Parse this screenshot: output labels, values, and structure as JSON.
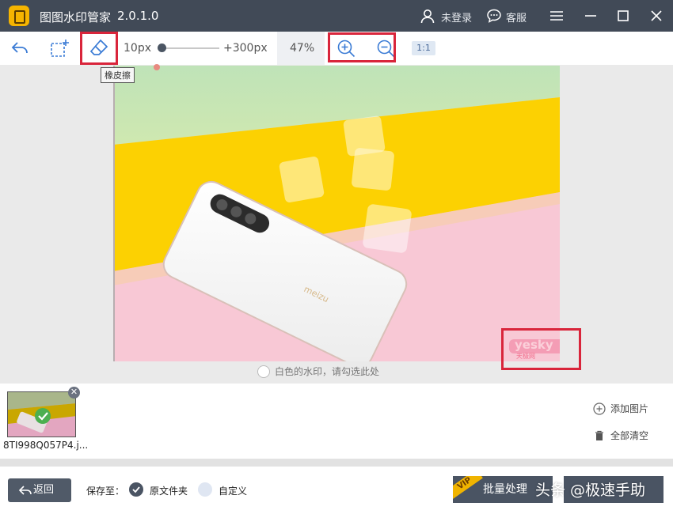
{
  "window": {
    "title": "图图水印管家",
    "version": "2.0.1.0",
    "login_label": "未登录",
    "service_label": "客服"
  },
  "toolbar": {
    "brush_min": "10px",
    "brush_max": "+300px",
    "zoom_level": "47%",
    "ratio_label": "1:1",
    "brush_level": 0.0
  },
  "tooltip": {
    "eraser": "橡皮擦"
  },
  "canvas": {
    "white_watermark_option": "白色的水印，请勾选此处",
    "photo_watermark": "yesky",
    "photo_watermark_sub": "天极网",
    "phone_brand": "meizu"
  },
  "files": [
    {
      "name": "8TI998Q057P4.j...",
      "checked": true
    }
  ],
  "side_actions": {
    "add_image": "添加图片",
    "clear_all": "全部清空"
  },
  "bottom": {
    "back_label": "返回",
    "save_to_label": "保存至：",
    "option_original": "原文件夹",
    "option_custom": "自定义",
    "batch_label": "批量处理",
    "vip_badge": "VIP",
    "overlay_watermark": "头条 @极速手助"
  },
  "colors": {
    "titlebar": "#414a57",
    "highlight": "#d9253b",
    "accent_blue": "#3a7bd5",
    "check": "#4caf50"
  }
}
